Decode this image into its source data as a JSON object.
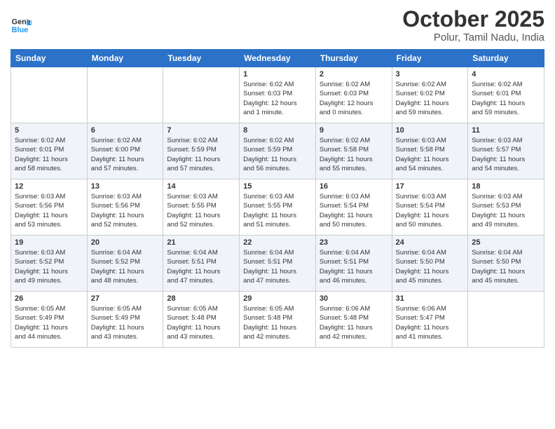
{
  "logo": {
    "line1": "General",
    "line2": "Blue"
  },
  "title": "October 2025",
  "subtitle": "Polur, Tamil Nadu, India",
  "days_of_week": [
    "Sunday",
    "Monday",
    "Tuesday",
    "Wednesday",
    "Thursday",
    "Friday",
    "Saturday"
  ],
  "weeks": [
    [
      {
        "day": "",
        "info": ""
      },
      {
        "day": "",
        "info": ""
      },
      {
        "day": "",
        "info": ""
      },
      {
        "day": "1",
        "info": "Sunrise: 6:02 AM\nSunset: 6:03 PM\nDaylight: 12 hours\nand 1 minute."
      },
      {
        "day": "2",
        "info": "Sunrise: 6:02 AM\nSunset: 6:03 PM\nDaylight: 12 hours\nand 0 minutes."
      },
      {
        "day": "3",
        "info": "Sunrise: 6:02 AM\nSunset: 6:02 PM\nDaylight: 11 hours\nand 59 minutes."
      },
      {
        "day": "4",
        "info": "Sunrise: 6:02 AM\nSunset: 6:01 PM\nDaylight: 11 hours\nand 59 minutes."
      }
    ],
    [
      {
        "day": "5",
        "info": "Sunrise: 6:02 AM\nSunset: 6:01 PM\nDaylight: 11 hours\nand 58 minutes."
      },
      {
        "day": "6",
        "info": "Sunrise: 6:02 AM\nSunset: 6:00 PM\nDaylight: 11 hours\nand 57 minutes."
      },
      {
        "day": "7",
        "info": "Sunrise: 6:02 AM\nSunset: 5:59 PM\nDaylight: 11 hours\nand 57 minutes."
      },
      {
        "day": "8",
        "info": "Sunrise: 6:02 AM\nSunset: 5:59 PM\nDaylight: 11 hours\nand 56 minutes."
      },
      {
        "day": "9",
        "info": "Sunrise: 6:02 AM\nSunset: 5:58 PM\nDaylight: 11 hours\nand 55 minutes."
      },
      {
        "day": "10",
        "info": "Sunrise: 6:03 AM\nSunset: 5:58 PM\nDaylight: 11 hours\nand 54 minutes."
      },
      {
        "day": "11",
        "info": "Sunrise: 6:03 AM\nSunset: 5:57 PM\nDaylight: 11 hours\nand 54 minutes."
      }
    ],
    [
      {
        "day": "12",
        "info": "Sunrise: 6:03 AM\nSunset: 5:56 PM\nDaylight: 11 hours\nand 53 minutes."
      },
      {
        "day": "13",
        "info": "Sunrise: 6:03 AM\nSunset: 5:56 PM\nDaylight: 11 hours\nand 52 minutes."
      },
      {
        "day": "14",
        "info": "Sunrise: 6:03 AM\nSunset: 5:55 PM\nDaylight: 11 hours\nand 52 minutes."
      },
      {
        "day": "15",
        "info": "Sunrise: 6:03 AM\nSunset: 5:55 PM\nDaylight: 11 hours\nand 51 minutes."
      },
      {
        "day": "16",
        "info": "Sunrise: 6:03 AM\nSunset: 5:54 PM\nDaylight: 11 hours\nand 50 minutes."
      },
      {
        "day": "17",
        "info": "Sunrise: 6:03 AM\nSunset: 5:54 PM\nDaylight: 11 hours\nand 50 minutes."
      },
      {
        "day": "18",
        "info": "Sunrise: 6:03 AM\nSunset: 5:53 PM\nDaylight: 11 hours\nand 49 minutes."
      }
    ],
    [
      {
        "day": "19",
        "info": "Sunrise: 6:03 AM\nSunset: 5:52 PM\nDaylight: 11 hours\nand 49 minutes."
      },
      {
        "day": "20",
        "info": "Sunrise: 6:04 AM\nSunset: 5:52 PM\nDaylight: 11 hours\nand 48 minutes."
      },
      {
        "day": "21",
        "info": "Sunrise: 6:04 AM\nSunset: 5:51 PM\nDaylight: 11 hours\nand 47 minutes."
      },
      {
        "day": "22",
        "info": "Sunrise: 6:04 AM\nSunset: 5:51 PM\nDaylight: 11 hours\nand 47 minutes."
      },
      {
        "day": "23",
        "info": "Sunrise: 6:04 AM\nSunset: 5:51 PM\nDaylight: 11 hours\nand 46 minutes."
      },
      {
        "day": "24",
        "info": "Sunrise: 6:04 AM\nSunset: 5:50 PM\nDaylight: 11 hours\nand 45 minutes."
      },
      {
        "day": "25",
        "info": "Sunrise: 6:04 AM\nSunset: 5:50 PM\nDaylight: 11 hours\nand 45 minutes."
      }
    ],
    [
      {
        "day": "26",
        "info": "Sunrise: 6:05 AM\nSunset: 5:49 PM\nDaylight: 11 hours\nand 44 minutes."
      },
      {
        "day": "27",
        "info": "Sunrise: 6:05 AM\nSunset: 5:49 PM\nDaylight: 11 hours\nand 43 minutes."
      },
      {
        "day": "28",
        "info": "Sunrise: 6:05 AM\nSunset: 5:48 PM\nDaylight: 11 hours\nand 43 minutes."
      },
      {
        "day": "29",
        "info": "Sunrise: 6:05 AM\nSunset: 5:48 PM\nDaylight: 11 hours\nand 42 minutes."
      },
      {
        "day": "30",
        "info": "Sunrise: 6:06 AM\nSunset: 5:48 PM\nDaylight: 11 hours\nand 42 minutes."
      },
      {
        "day": "31",
        "info": "Sunrise: 6:06 AM\nSunset: 5:47 PM\nDaylight: 11 hours\nand 41 minutes."
      },
      {
        "day": "",
        "info": ""
      }
    ]
  ]
}
